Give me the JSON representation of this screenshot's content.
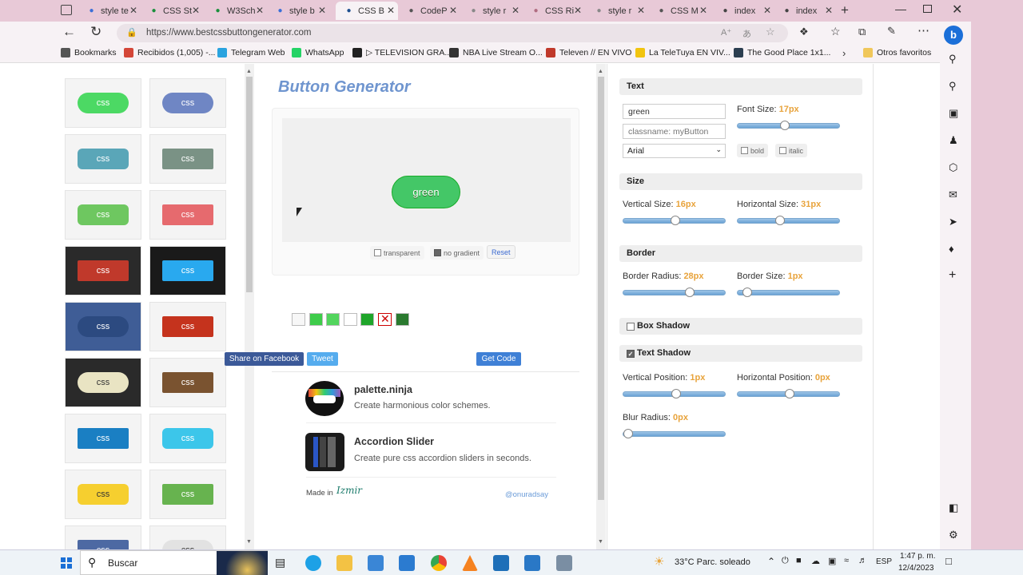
{
  "browser": {
    "tabs": [
      {
        "label": "style te",
        "icon": "search-icon",
        "color": "#3a6fd8"
      },
      {
        "label": "CSS St",
        "icon": "w3schools-icon",
        "color": "#1a8f3c"
      },
      {
        "label": "W3Sch",
        "icon": "w3schools-icon",
        "color": "#1a8f3c"
      },
      {
        "label": "style b",
        "icon": "search-icon",
        "color": "#3a6fd8"
      },
      {
        "label": "CSS B",
        "icon": "close-x-icon",
        "color": "#1d4f8f"
      },
      {
        "label": "CodeP",
        "icon": "gear-icon",
        "color": "#555555"
      },
      {
        "label": "style r",
        "icon": "search-icon",
        "color": "#888888"
      },
      {
        "label": "CSS Ri",
        "icon": "document-icon",
        "color": "#b06d82"
      },
      {
        "label": "style r",
        "icon": "search-icon",
        "color": "#888888"
      },
      {
        "label": "CSS M",
        "icon": "gear-icon",
        "color": "#555555"
      },
      {
        "label": "index",
        "icon": "file-icon",
        "color": "#444444"
      },
      {
        "label": "index",
        "icon": "file-icon",
        "color": "#444444"
      }
    ],
    "url": "https://www.bestcssbuttongenerator.com",
    "bookmarks": [
      {
        "label": "Bookmarks",
        "icon": "bookmarks-icon",
        "color": "#555555"
      },
      {
        "label": "Recibidos (1,005) -...",
        "icon": "gmail-icon",
        "color": "#d44638"
      },
      {
        "label": "Telegram Web",
        "icon": "telegram-icon",
        "color": "#2aa3df"
      },
      {
        "label": "WhatsApp",
        "icon": "whatsapp-icon",
        "color": "#25d366"
      },
      {
        "label": "▷ TELEVISION GRA...",
        "icon": "hd-icon",
        "color": "#222222"
      },
      {
        "label": "NBA Live Stream O...",
        "icon": "nba-icon",
        "color": "#333333"
      },
      {
        "label": "Televen // EN VIVO",
        "icon": "televen-icon",
        "color": "#c0392b"
      },
      {
        "label": "La TeleTuya EN VIV...",
        "icon": "teletuya-icon",
        "color": "#f1c40f"
      },
      {
        "label": "The Good Place 1x1...",
        "icon": "goodplace-icon",
        "color": "#2c3e50"
      }
    ],
    "other_favorites": "Otros favoritos"
  },
  "page": {
    "heading": "Button Generator",
    "preview_button": "green",
    "thumbnail_label": "css",
    "thumbnails": [
      {
        "bg": "#4cd964",
        "fg": "#fff",
        "shape": "pill"
      },
      {
        "bg": "#6f86c4",
        "fg": "#fff",
        "shape": "pill"
      },
      {
        "bg": "#5aa6b8",
        "fg": "#fff",
        "shape": "round"
      },
      {
        "bg": "#7a9285",
        "fg": "#fff",
        "shape": "square"
      },
      {
        "bg": "#6ec760",
        "fg": "#fff",
        "shape": "round"
      },
      {
        "bg": "#e66a6e",
        "fg": "#fff",
        "shape": "square"
      },
      {
        "bg": "#c0392b",
        "fg": "#fff",
        "shape": "square",
        "frame": "#2a2a2a"
      },
      {
        "bg": "#29a9ef",
        "fg": "#fff",
        "shape": "square",
        "frame": "#1a1a1a"
      },
      {
        "bg": "#2c4a80",
        "fg": "#fff",
        "shape": "pill",
        "frame": "#3f5d96"
      },
      {
        "bg": "#c5331d",
        "fg": "#fff",
        "shape": "square"
      },
      {
        "bg": "#e9e4c3",
        "fg": "#333",
        "shape": "pill",
        "frame": "#2a2a2a"
      },
      {
        "bg": "#7a5330",
        "fg": "#fff",
        "shape": "square"
      },
      {
        "bg": "#1a7fc3",
        "fg": "#fff",
        "shape": "square"
      },
      {
        "bg": "#3cc6ea",
        "fg": "#fff",
        "shape": "round"
      },
      {
        "bg": "#f6cf2f",
        "fg": "#333",
        "shape": "round"
      },
      {
        "bg": "#67b34f",
        "fg": "#fff",
        "shape": "square"
      },
      {
        "bg": "#4d69a3",
        "fg": "#fff",
        "shape": "square"
      },
      {
        "bg": "#e2e2e2",
        "fg": "#333",
        "shape": "pill"
      }
    ],
    "swatches": [
      "#f7f7f7",
      "#3ecc4a",
      "#52d55d",
      "#ffffff",
      "#1fa52a",
      "#ffffff",
      "#2a7a2f"
    ],
    "transparent_label": "transparent",
    "no_gradient_label": "no gradient",
    "reset_label": "Reset",
    "share_facebook": "Share on Facebook",
    "tweet": "Tweet",
    "get_code": "Get Code",
    "promos": [
      {
        "title": "palette.ninja",
        "desc": "Create harmonious color schemes."
      },
      {
        "title": "Accordion Slider",
        "desc": "Create pure css accordion sliders in seconds."
      }
    ],
    "made_in": "Made in",
    "made_in_logo": "Izmir",
    "twitter_handle": "@onuradsay"
  },
  "panel": {
    "text_section": "Text",
    "text_value": "green",
    "classname_placeholder": "classname: myButton",
    "font_family": "Arial",
    "font_size_label": "Font Size:",
    "font_size_value": "17px",
    "font_size_level": 0.45,
    "bold_label": "bold",
    "italic_label": "italic",
    "size_section": "Size",
    "vertical_size_label": "Vertical Size:",
    "vertical_size_value": "16px",
    "vertical_size_level": 0.5,
    "horizontal_size_label": "Horizontal Size:",
    "horizontal_size_value": "31px",
    "horizontal_size_level": 0.4,
    "border_section": "Border",
    "border_radius_label": "Border Radius:",
    "border_radius_value": "28px",
    "border_radius_level": 0.66,
    "border_size_label": "Border Size:",
    "border_size_value": "1px",
    "border_size_level": 0.05,
    "box_shadow_section": "Box Shadow",
    "box_shadow_checked": false,
    "text_shadow_section": "Text Shadow",
    "text_shadow_checked": true,
    "vertical_position_label": "Vertical Position:",
    "vertical_position_value": "1px",
    "vertical_position_level": 0.51,
    "horizontal_position_label": "Horizontal Position:",
    "horizontal_position_value": "0px",
    "horizontal_position_level": 0.5,
    "blur_radius_label": "Blur Radius:",
    "blur_radius_value": "0px",
    "blur_radius_level": 0.0
  },
  "taskbar": {
    "search_label": "Buscar",
    "weather": "33°C  Parc. soleado",
    "language": "ESP",
    "time": "1:47 p. m.",
    "date": "12/4/2023"
  }
}
